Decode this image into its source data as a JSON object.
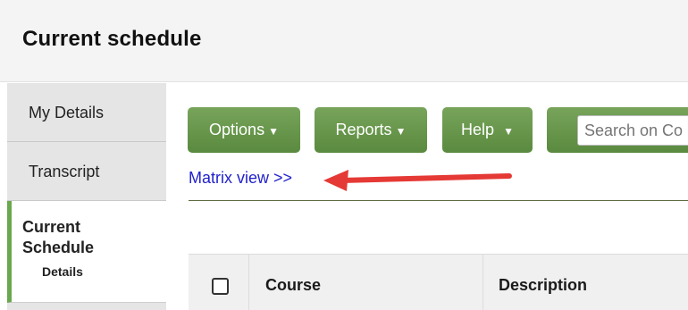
{
  "header": {
    "title": "Current schedule"
  },
  "sidebar": {
    "items": [
      {
        "label": "My Details"
      },
      {
        "label": "Transcript"
      },
      {
        "label": "Current Schedule",
        "sub_label": "Details"
      }
    ]
  },
  "toolbar": {
    "options_label": "Options",
    "reports_label": "Reports",
    "help_label": "Help",
    "search_placeholder": "Search on Co"
  },
  "links": {
    "matrix_view": "Matrix view >>"
  },
  "annotation": {
    "arrow_color": "#e53935",
    "icon": "arrow-left-icon"
  },
  "table": {
    "columns": [
      "Course",
      "Description"
    ]
  },
  "colors": {
    "accent_green": "#6aa84f",
    "link_blue": "#2222cc"
  }
}
